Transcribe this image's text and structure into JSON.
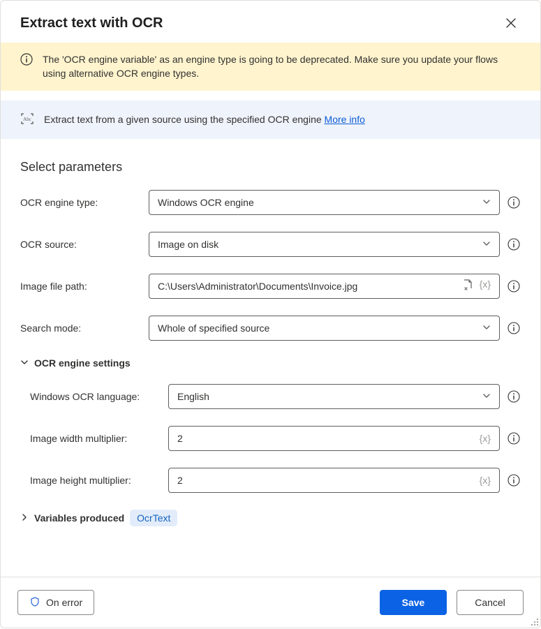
{
  "dialog": {
    "title": "Extract text with OCR"
  },
  "warning": {
    "message": "The 'OCR engine variable' as an engine type is going to be deprecated.  Make sure you update your flows using alternative OCR engine types."
  },
  "infoBanner": {
    "text": "Extract text from a given source using the specified OCR engine ",
    "link": "More info"
  },
  "section": {
    "title": "Select parameters"
  },
  "fields": {
    "engineType": {
      "label": "OCR engine type:",
      "value": "Windows OCR engine"
    },
    "source": {
      "label": "OCR source:",
      "value": "Image on disk"
    },
    "filePath": {
      "label": "Image file path:",
      "value": "C:\\Users\\Administrator\\Documents\\Invoice.jpg"
    },
    "searchMode": {
      "label": "Search mode:",
      "value": "Whole of specified source"
    }
  },
  "engineSettings": {
    "header": "OCR engine settings",
    "language": {
      "label": "Windows OCR language:",
      "value": "English"
    },
    "widthMult": {
      "label": "Image width multiplier:",
      "value": "2"
    },
    "heightMult": {
      "label": "Image height multiplier:",
      "value": "2"
    }
  },
  "variables": {
    "header": "Variables produced",
    "pill": "OcrText"
  },
  "footer": {
    "onError": "On error",
    "save": "Save",
    "cancel": "Cancel"
  },
  "icons": {
    "close": "close-icon",
    "info": "info-circle-icon",
    "ocr": "ocr-box-icon",
    "caret": "chevron-down-icon",
    "help": "info-circle-icon",
    "file": "file-select-icon",
    "var": "variable-icon",
    "expand": "chevron-down-small-icon",
    "collapse": "chevron-right-small-icon",
    "shield": "shield-icon"
  }
}
